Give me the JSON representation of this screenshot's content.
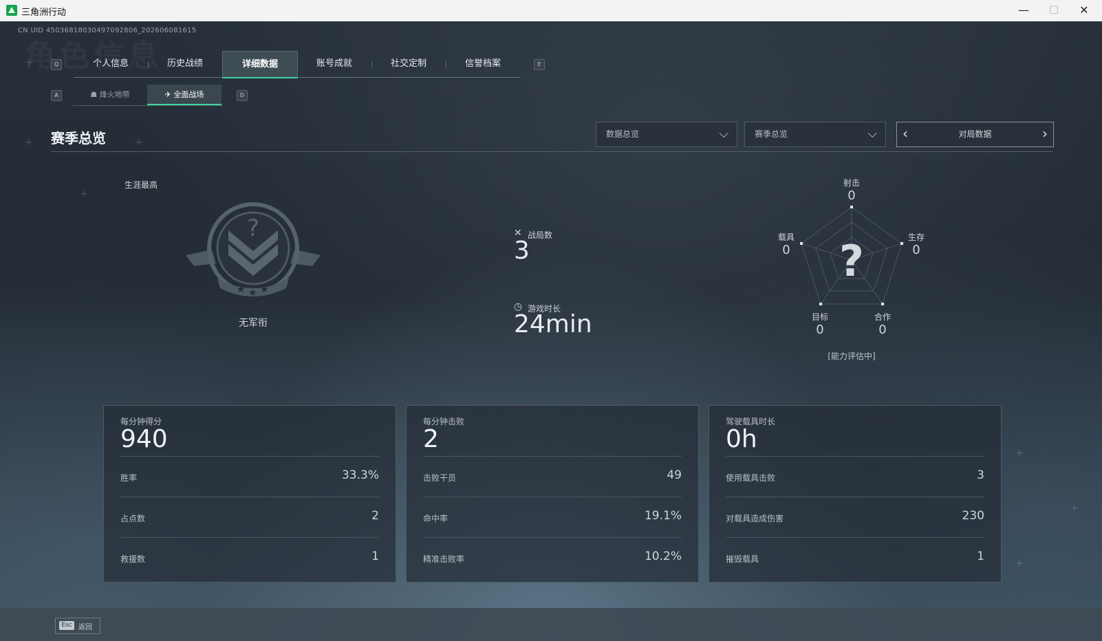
{
  "window": {
    "app_title": "三角洲行动",
    "controls": {
      "minimize": "—",
      "maximize": "☐",
      "close": "✕"
    }
  },
  "header": {
    "uid": "CN UID 4503681803049709​2806_202606081615",
    "bg_title": "角色信息"
  },
  "tabs": {
    "left_key": "Q",
    "right_key": "E",
    "items": [
      "个人信息",
      "历史战绩",
      "详细数据",
      "账号成就",
      "社交定制",
      "信誉档案"
    ],
    "active_index": 2
  },
  "subtabs": {
    "left_key": "A",
    "right_key": "D",
    "items": [
      "烽火地带",
      "全面战场"
    ],
    "active_index": 1
  },
  "section": {
    "title": "赛季总览"
  },
  "filters": {
    "dropdown1": "数据总览",
    "dropdown2": "赛季总览",
    "pager_label": "对局数据"
  },
  "career": {
    "label": "生涯最高",
    "rank_name": "无军衔"
  },
  "stats": {
    "matches_label": "战局数",
    "matches_value": "3",
    "playtime_label": "游戏时长",
    "playtime_value": "24min"
  },
  "radar": {
    "center_mark": "?",
    "status": "[能力评估中]",
    "axes": [
      {
        "label": "射击",
        "value": "0"
      },
      {
        "label": "生存",
        "value": "0"
      },
      {
        "label": "合作",
        "value": "0"
      },
      {
        "label": "目标",
        "value": "0"
      },
      {
        "label": "载具",
        "value": "0"
      }
    ]
  },
  "cards": [
    {
      "head_label": "每分钟得分",
      "head_value": "940",
      "rows": [
        {
          "k": "胜率",
          "v": "33.3%"
        },
        {
          "k": "占点数",
          "v": "2"
        },
        {
          "k": "救援数",
          "v": "1"
        }
      ]
    },
    {
      "head_label": "每分钟击败",
      "head_value": "2",
      "rows": [
        {
          "k": "击败干员",
          "v": "49"
        },
        {
          "k": "命中率",
          "v": "19.1%"
        },
        {
          "k": "精准击败率",
          "v": "10.2%"
        }
      ]
    },
    {
      "head_label": "驾驶载具时长",
      "head_value": "0h",
      "rows": [
        {
          "k": "使用载具击败",
          "v": "3"
        },
        {
          "k": "对载具造成伤害",
          "v": "230"
        },
        {
          "k": "摧毁载具",
          "v": "1"
        }
      ]
    }
  ],
  "footer": {
    "esc_key": "Esc",
    "esc_label": "返回"
  }
}
